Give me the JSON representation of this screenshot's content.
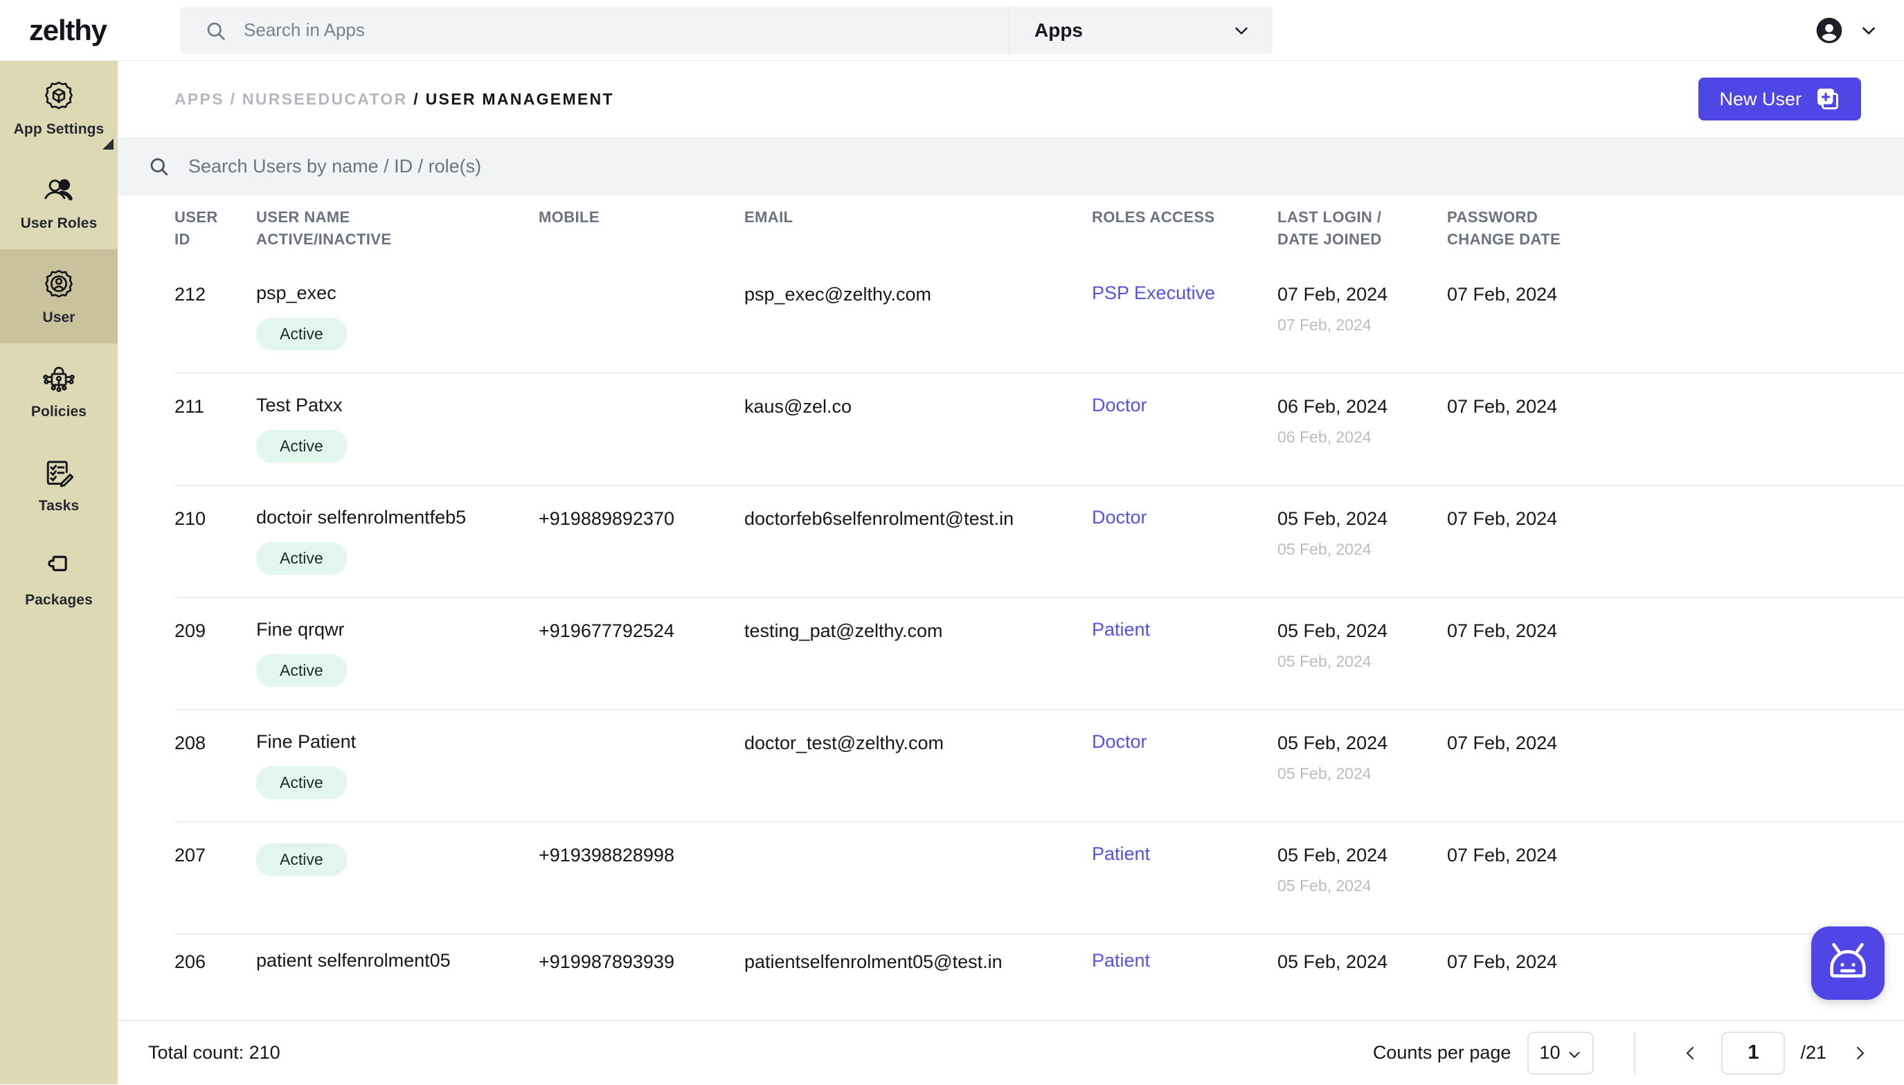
{
  "brand": "zelthy",
  "topbar": {
    "search_placeholder": "Search in Apps",
    "search_value": "",
    "scope_label": "Apps",
    "icons": {
      "search": "search-icon",
      "chevron": "chevron-down-icon",
      "avatar": "account-circle-icon"
    }
  },
  "sidebar": {
    "items": [
      {
        "label": "App Settings",
        "icon": "gear-cube-icon",
        "active": false
      },
      {
        "label": "User Roles",
        "icon": "people-icon",
        "active": false
      },
      {
        "label": "User",
        "icon": "gear-person-icon",
        "active": true
      },
      {
        "label": "Policies",
        "icon": "policy-network-icon",
        "active": false
      },
      {
        "label": "Tasks",
        "icon": "checklist-edit-icon",
        "active": false
      },
      {
        "label": "Packages",
        "icon": "puzzle-piece-icon",
        "active": false
      }
    ]
  },
  "breadcrumb": {
    "parts": [
      "APPS",
      "NURSEEDUCATOR"
    ],
    "separator": "/",
    "current": "USER MANAGEMENT",
    "text_dim": "APPS / NURSEEDUCATOR",
    "text_sep": "/",
    "text_current": "USER MANAGEMENT"
  },
  "actions": {
    "new_user_label": "New User",
    "new_user_icon": "add-square-icon"
  },
  "users_search": {
    "placeholder": "Search Users by name / ID / role(s)",
    "value": "",
    "icon": "search-icon"
  },
  "table": {
    "columns": [
      {
        "line1": "USER",
        "line2": "ID"
      },
      {
        "line1": "USER NAME",
        "line2": "ACTIVE/INACTIVE"
      },
      {
        "line1": "MOBILE",
        "line2": ""
      },
      {
        "line1": "EMAIL",
        "line2": ""
      },
      {
        "line1": "ROLES ACCESS",
        "line2": ""
      },
      {
        "line1": "LAST LOGIN /",
        "line2": "DATE JOINED"
      },
      {
        "line1": "PASSWORD",
        "line2": "CHANGE DATE"
      }
    ],
    "rows": [
      {
        "id": "212",
        "name": "psp_exec",
        "status": "Active",
        "mobile": "",
        "email": "psp_exec@zelthy.com",
        "role": "PSP Executive",
        "last_login": "07 Feb, 2024",
        "date_joined": "07 Feb, 2024",
        "password_change": "07 Feb, 2024"
      },
      {
        "id": "211",
        "name": "Test Patxx",
        "status": "Active",
        "mobile": "",
        "email": "kaus@zel.co",
        "role": "Doctor",
        "last_login": "06 Feb, 2024",
        "date_joined": "06 Feb, 2024",
        "password_change": "07 Feb, 2024"
      },
      {
        "id": "210",
        "name": "doctoir selfenrolmentfeb5",
        "status": "Active",
        "mobile": "+919889892370",
        "email": "doctorfeb6selfenrolment@test.in",
        "role": "Doctor",
        "last_login": "05 Feb, 2024",
        "date_joined": "05 Feb, 2024",
        "password_change": "07 Feb, 2024"
      },
      {
        "id": "209",
        "name": "Fine qrqwr",
        "status": "Active",
        "mobile": "+919677792524",
        "email": "testing_pat@zelthy.com",
        "role": "Patient",
        "last_login": "05 Feb, 2024",
        "date_joined": "05 Feb, 2024",
        "password_change": "07 Feb, 2024"
      },
      {
        "id": "208",
        "name": "Fine Patient",
        "status": "Active",
        "mobile": "",
        "email": "doctor_test@zelthy.com",
        "role": "Doctor",
        "last_login": "05 Feb, 2024",
        "date_joined": "05 Feb, 2024",
        "password_change": "07 Feb, 2024"
      },
      {
        "id": "207",
        "name": "",
        "status": "Active",
        "mobile": "+919398828998",
        "email": "",
        "role": "Patient",
        "last_login": "05 Feb, 2024",
        "date_joined": "05 Feb, 2024",
        "password_change": "07 Feb, 2024"
      },
      {
        "id": "206",
        "name": "patient selfenrolment05",
        "status": "",
        "mobile": "+919987893939",
        "email": "patientselfenrolment05@test.in",
        "role": "Patient",
        "last_login": "05 Feb, 2024",
        "date_joined": "",
        "password_change": "07 Feb, 2024"
      }
    ]
  },
  "footer": {
    "total_count": "Total count: 210",
    "counts_per_page_label": "Counts per page",
    "counts_per_page_value": "10",
    "page_value": "1",
    "page_total": "/21",
    "prev_icon": "chevron-left-icon",
    "next_icon": "chevron-right-icon"
  },
  "chat": {
    "icon": "robot-assistant-icon"
  },
  "colors": {
    "sidebar_bg": "#ded9b5",
    "sidebar_active": "#c9c29d",
    "accent": "#4f46e5",
    "role_link": "#5551e8",
    "badge_bg": "#e2f6ed",
    "search_bg": "#f2f3f5"
  }
}
